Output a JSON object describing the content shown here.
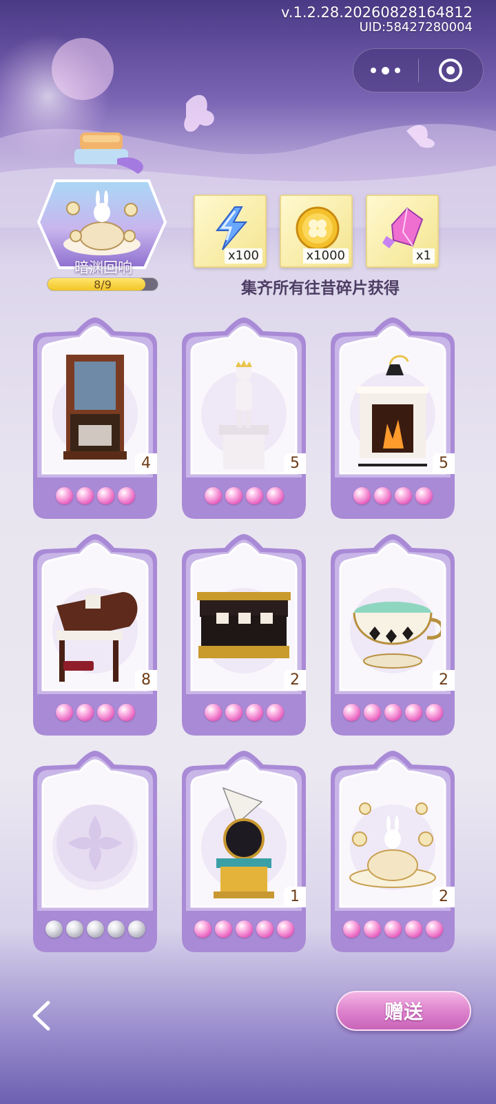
{
  "header": {
    "version": "v.1.2.28.20260828164812",
    "uid": "UID:58427280004"
  },
  "capsule": {
    "more_icon": "more-dots-icon",
    "close_icon": "target-circle-icon"
  },
  "collection": {
    "name": "暗渊回响",
    "progress_text": "8/9",
    "progress_value": 0.889,
    "rewards": [
      {
        "icon": "lightning-icon",
        "qty": "x100"
      },
      {
        "icon": "gold-clover-coin-icon",
        "qty": "x1000"
      },
      {
        "icon": "pink-crystal-icon",
        "qty": "x1"
      }
    ],
    "tip": "集齐所有往昔碎片获得"
  },
  "cards": [
    {
      "item": "fireplace-cabinet",
      "count": "4",
      "pearls": 4,
      "owned": true
    },
    {
      "item": "prince-statue",
      "count": "5",
      "pearls": 4,
      "owned": true
    },
    {
      "item": "white-fireplace",
      "count": "5",
      "pearls": 4,
      "owned": true
    },
    {
      "item": "grand-piano",
      "count": "8",
      "pearls": 4,
      "owned": true
    },
    {
      "item": "black-sofa",
      "count": "2",
      "pearls": 4,
      "owned": true
    },
    {
      "item": "teacup",
      "count": "2",
      "pearls": 5,
      "owned": true
    },
    {
      "item": "empty-slot",
      "count": "",
      "pearls": 5,
      "owned": false
    },
    {
      "item": "ship-globe",
      "count": "1",
      "pearls": 5,
      "owned": true
    },
    {
      "item": "rabbit-teacup-carousel",
      "count": "2",
      "pearls": 5,
      "owned": true
    }
  ],
  "footer": {
    "back_icon": "back-chevron-icon",
    "gift_label": "赠送"
  },
  "colors": {
    "accent": "#9a7bd0",
    "gift_button": "#de83cd",
    "pearl_pink": "#e964c0"
  }
}
